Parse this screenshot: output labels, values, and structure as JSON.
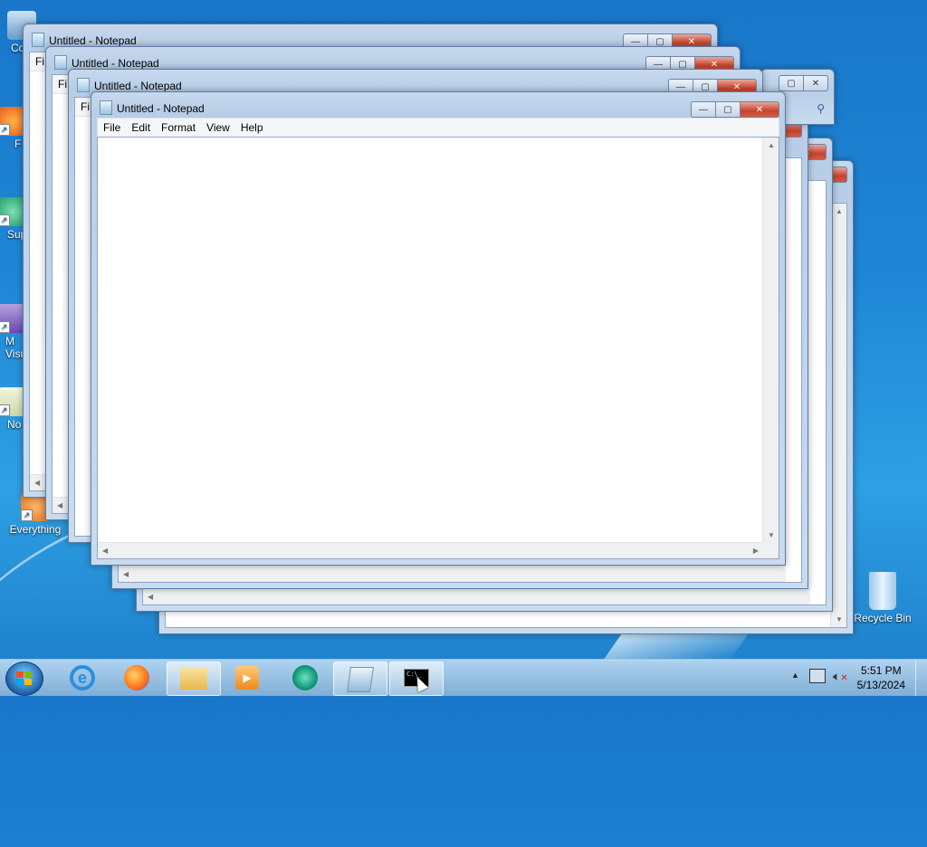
{
  "desktop": {
    "icons": [
      {
        "label": "Co",
        "name": "computer"
      },
      {
        "label": "F",
        "name": "firefox"
      },
      {
        "label": "Sup",
        "name": "support"
      },
      {
        "label": "M\nVisu",
        "name": "visual-studio"
      },
      {
        "label": "No",
        "name": "notepad"
      },
      {
        "label": "Everything",
        "name": "everything"
      },
      {
        "label": "Recycle Bin",
        "name": "recycle-bin"
      }
    ]
  },
  "windows": [
    {
      "title": "Untitled - Notepad",
      "menu_first": "Fi"
    },
    {
      "title": "Untitled - Notepad",
      "menu_first": "Fi"
    },
    {
      "title": "Untitled - Notepad",
      "menu_first": "Fi"
    },
    {
      "title": "Untitled - Notepad",
      "menu": [
        "File",
        "Edit",
        "Format",
        "View",
        "Help"
      ]
    }
  ],
  "caption_buttons": {
    "minimize": "—",
    "maximize": "▢",
    "close": "✕"
  },
  "taskbar": {
    "items": [
      "internet-explorer",
      "firefox",
      "file-explorer",
      "media-player",
      "sync-app",
      "notepad",
      "command-prompt"
    ],
    "clock_time": "5:51 PM",
    "clock_date": "5/13/2024"
  },
  "colors": {
    "close_button": "#c7422c",
    "title_bar": "#b8cde6"
  }
}
